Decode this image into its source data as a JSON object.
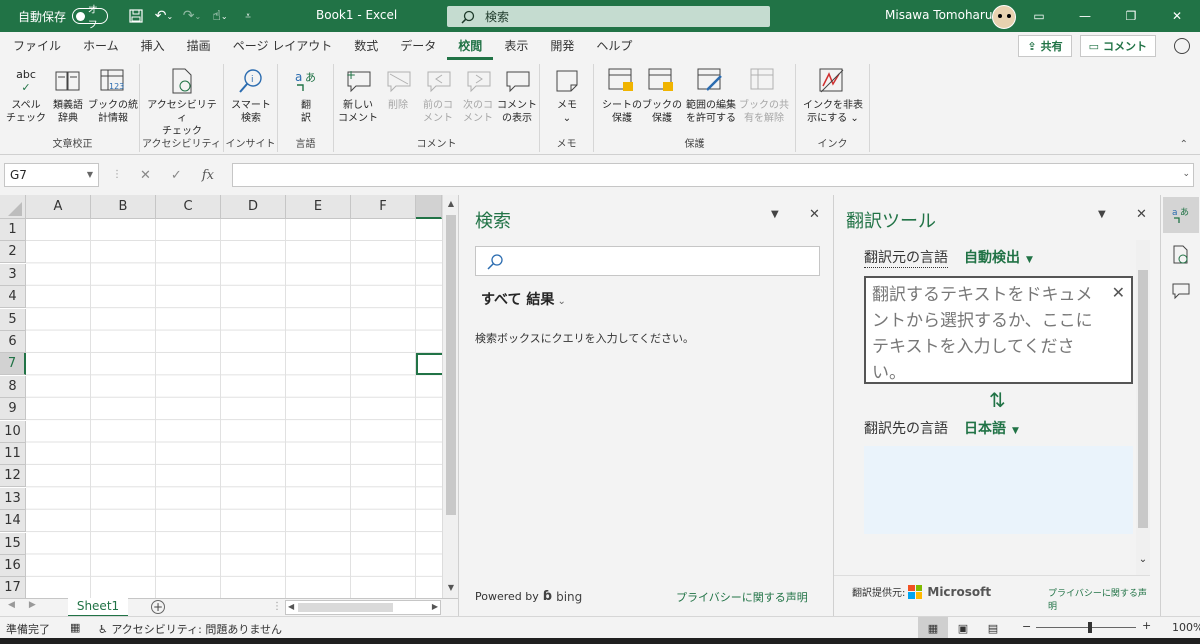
{
  "titlebar": {
    "autosave_label": "自動保存",
    "autosave_state": "オフ",
    "doc_title": "Book1  -  Excel",
    "search_placeholder": "検索",
    "user_name": "Misawa Tomoharu"
  },
  "tabs": [
    "ファイル",
    "ホーム",
    "挿入",
    "描画",
    "ページ レイアウト",
    "数式",
    "データ",
    "校閲",
    "表示",
    "開発",
    "ヘルプ"
  ],
  "active_tab": "校閲",
  "tab_actions": {
    "share": "共有",
    "comment": "コメント"
  },
  "ribbon": {
    "groups": {
      "proofing": "文章校正",
      "accessibility": "アクセシビリティ",
      "insights": "インサイト",
      "language": "言語",
      "comments": "コメント",
      "notes": "メモ",
      "protect": "保護",
      "ink": "インク"
    },
    "buttons": {
      "spelling": [
        "スペル",
        "チェック"
      ],
      "thesaurus": [
        "類義語",
        "辞典"
      ],
      "workbook_stats": [
        "ブックの統",
        "計情報"
      ],
      "check_accessibility": [
        "アクセシビリティ",
        "チェック"
      ],
      "smart_lookup": [
        "スマート",
        "検索"
      ],
      "translate": [
        "翻",
        "訳"
      ],
      "new_comment": [
        "新しい",
        "コメント"
      ],
      "delete": [
        "削除",
        ""
      ],
      "prev_comment": [
        "前のコ",
        "メント"
      ],
      "next_comment": [
        "次のコ",
        "メント"
      ],
      "show_comments": [
        "コメント",
        "の表示"
      ],
      "notes": [
        "メモ",
        "⌄"
      ],
      "protect_sheet": [
        "シートの",
        "保護"
      ],
      "protect_workbook": [
        "ブックの",
        "保護"
      ],
      "allow_edit_ranges": [
        "範囲の編集",
        "を許可する"
      ],
      "unshare_workbook": [
        "ブックの共",
        "有を解除"
      ],
      "hide_ink": [
        "インクを非表",
        "示にする ⌄"
      ]
    }
  },
  "formula_bar": {
    "name_box": "G7",
    "fx": "fx",
    "value": ""
  },
  "grid": {
    "columns": [
      "A",
      "B",
      "C",
      "D",
      "E",
      "F"
    ],
    "rows": [
      "1",
      "2",
      "3",
      "4",
      "5",
      "6",
      "7",
      "8",
      "9",
      "10",
      "11",
      "12",
      "13",
      "14",
      "15",
      "16",
      "17"
    ],
    "selected_cell": "G7"
  },
  "sheets": {
    "active": "Sheet1"
  },
  "search_pane": {
    "title": "検索",
    "results_label": "すべて 結果",
    "hint": "検索ボックスにクエリを入力してください。",
    "powered_by": "Powered by",
    "engine": "bing",
    "privacy": "プライバシーに関する声明"
  },
  "translator_pane": {
    "title": "翻訳ツール",
    "source_label": "翻訳元の言語",
    "source_lang": "自動検出",
    "input_placeholder": "翻訳するテキストをドキュメントから選択するか、ここにテキストを入力してください。",
    "target_label": "翻訳先の言語",
    "target_lang": "日本語",
    "provider_label": "翻訳提供元:",
    "provider": "Microsoft",
    "privacy": "プライバシーに関する声明"
  },
  "statusbar": {
    "ready": "準備完了",
    "accessibility": "アクセシビリティ: 問題ありません",
    "zoom": "100%"
  },
  "colors": {
    "accent": "#217346",
    "titlebar": "#217346"
  }
}
